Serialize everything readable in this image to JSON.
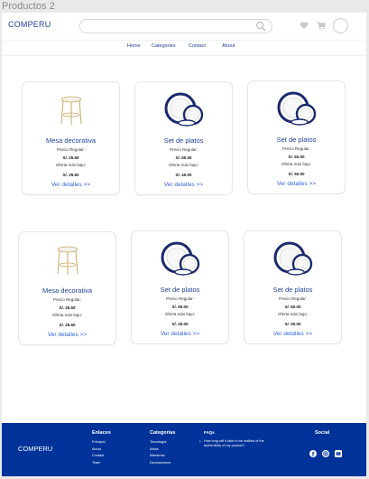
{
  "frame_label": "Productos 2",
  "header": {
    "logo": "COMPERU",
    "search_placeholder": "",
    "icons": [
      "search-icon",
      "heart-icon",
      "cart-icon",
      "avatar"
    ]
  },
  "nav": {
    "items": [
      "Home",
      "Categories",
      "Contact",
      "About"
    ]
  },
  "products": [
    {
      "name": "Mesa decorativa",
      "regular_label": "Precio Regular:",
      "regular_price": "S/. 25.50",
      "offer_label": "Oferta más bajo:",
      "offer_price": "S/. 25.50",
      "link": "Ver detalles >>",
      "image": "side-table"
    },
    {
      "name": "Set de platos",
      "regular_label": "Precio Regular:",
      "regular_price": "S/. 50.00",
      "offer_label": "Oferta más bajo:",
      "offer_price": "S/. 40.00",
      "link": "Ver detalles >>",
      "image": "plates"
    },
    {
      "name": "Set de platos",
      "regular_label": "Precio Regular:",
      "regular_price": "S/. 60.00",
      "offer_label": "Oferta más bajo:",
      "offer_price": "S/. 50.00",
      "link": "Ver detalles >>",
      "image": "plates"
    },
    {
      "name": "Mesa decorativa",
      "regular_label": "Precio Regular:",
      "regular_price": "S/. 25.50",
      "offer_label": "Oferta más bajo:",
      "offer_price": "S/. 25.50",
      "link": "Ver detalles >>",
      "image": "side-table"
    },
    {
      "name": "Set de platos",
      "regular_label": "Precio Regular:",
      "regular_price": "S/. 50.00",
      "offer_label": "Oferta más bajo:",
      "offer_price": "S/. 40.00",
      "link": "Ver detalles >>",
      "image": "plates"
    },
    {
      "name": "Set de platos",
      "regular_label": "Precio Regular:",
      "regular_price": "S/. 60.00",
      "offer_label": "Oferta más bajo:",
      "offer_price": "S/. 50.00",
      "link": "Ver detalles >>",
      "image": "plates"
    }
  ],
  "footer": {
    "logo": "COMPERU",
    "enlaces": {
      "heading": "Enlaces",
      "links": [
        "Principal",
        "About",
        "Contact",
        "Team"
      ]
    },
    "categorias": {
      "heading": "Categorías",
      "links": [
        "Tecnología",
        "Moda",
        "Maestrías",
        "Decoraciones"
      ]
    },
    "faq": {
      "heading": "FAQs",
      "question": "How long will it take to be notified of the authenticity of my product?"
    },
    "social": {
      "heading": "Social",
      "icons": [
        "facebook-icon",
        "instagram-icon",
        "youtube-icon"
      ]
    }
  },
  "colors": {
    "brand": "#003399",
    "link": "#2f63d6",
    "text_blue": "#1f3f99"
  }
}
